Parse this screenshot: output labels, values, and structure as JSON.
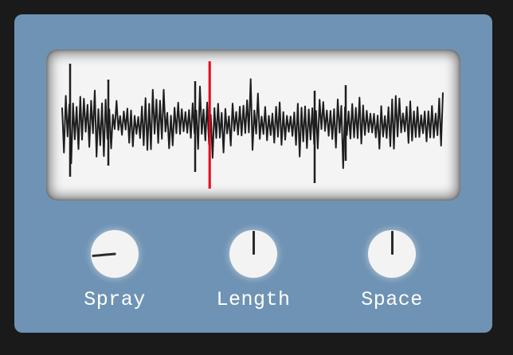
{
  "waveform": {
    "playhead_position": 0.4,
    "waveform_color": "#1e1e1e",
    "playhead_color": "#e8001c",
    "background_color": "#f4f4f4"
  },
  "knobs": [
    {
      "label": "Spray",
      "value": 0.24,
      "angle_deg": -95
    },
    {
      "label": "Length",
      "value": 0.5,
      "angle_deg": 0
    },
    {
      "label": "Space",
      "value": 0.5,
      "angle_deg": 0
    }
  ],
  "colors": {
    "panel": "#6f93b4",
    "background": "#1a1a1a",
    "knob": "#f3f3f3",
    "label_text": "#ffffff"
  }
}
